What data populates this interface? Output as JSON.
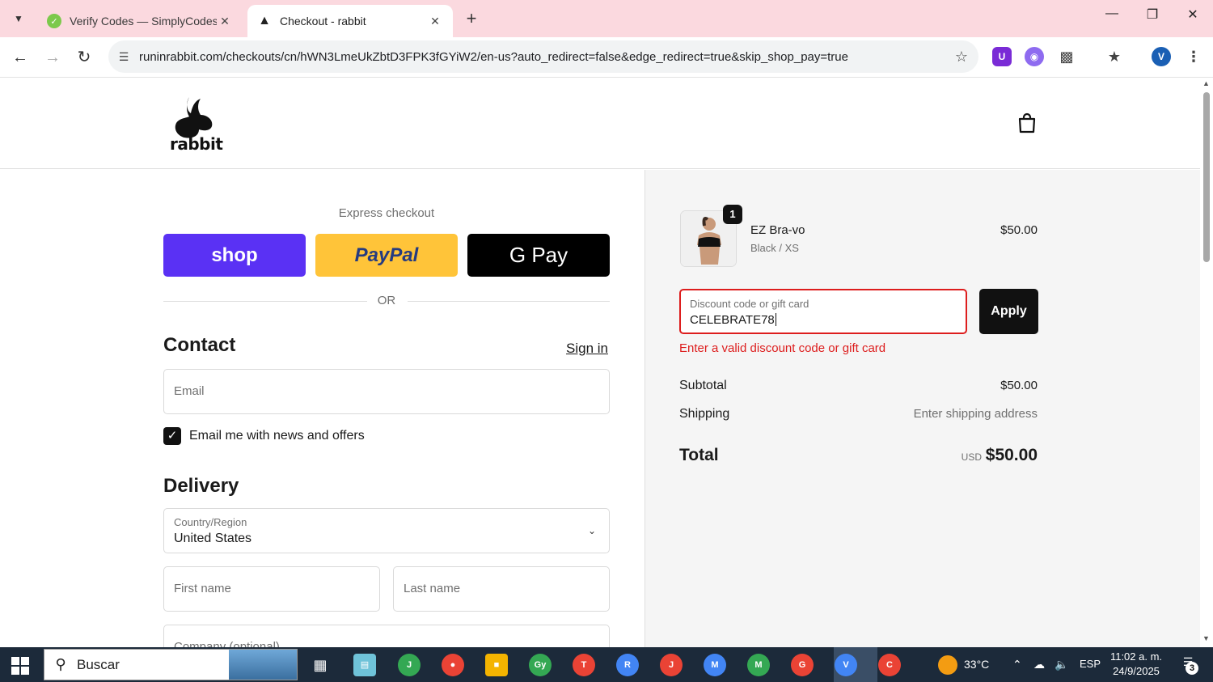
{
  "browser": {
    "tabs": [
      {
        "title": "Verify Codes — SimplyCodes",
        "active": false
      },
      {
        "title": "Checkout - rabbit",
        "active": true
      }
    ],
    "url": "runinrabbit.com/checkouts/cn/hWN3LmeUkZbtD3FPK3fGYiW2/en-us?auto_redirect=false&edge_redirect=true&skip_shop_pay=true",
    "profile_initial": "V"
  },
  "header": {
    "logo_text": "rabbit"
  },
  "express": {
    "label": "Express checkout",
    "shop_label": "shop",
    "paypal_label": "PayPal",
    "gpay_label": "G Pay",
    "or_text": "OR"
  },
  "contact": {
    "heading": "Contact",
    "signin_label": "Sign in",
    "email_placeholder": "Email",
    "newsletter_label": "Email me with news and offers",
    "newsletter_checked": true
  },
  "delivery": {
    "heading": "Delivery",
    "country_label": "Country/Region",
    "country_value": "United States",
    "first_name_placeholder": "First name",
    "last_name_placeholder": "Last name",
    "company_placeholder": "Company (optional)"
  },
  "summary": {
    "item": {
      "quantity": "1",
      "name": "EZ Bra-vo",
      "variant": "Black / XS",
      "price": "$50.00"
    },
    "discount": {
      "label": "Discount code or gift card",
      "value": "CELEBRATE78",
      "apply_label": "Apply",
      "error": "Enter a valid discount code or gift card"
    },
    "subtotal_label": "Subtotal",
    "subtotal_value": "$50.00",
    "shipping_label": "Shipping",
    "shipping_value": "Enter shipping address",
    "total_label": "Total",
    "total_currency": "USD",
    "total_value": "$50.00"
  },
  "taskbar": {
    "search_text": "Buscar",
    "weather": "33°C",
    "language": "ESP",
    "time": "11:02 a. m.",
    "date": "24/9/2025",
    "notifications": "3"
  },
  "colors": {
    "tabbar_bg": "#fbd9df",
    "shop_purple": "#5a31f4",
    "paypal_yellow": "#ffc439",
    "error_red": "#dd1d1d"
  }
}
